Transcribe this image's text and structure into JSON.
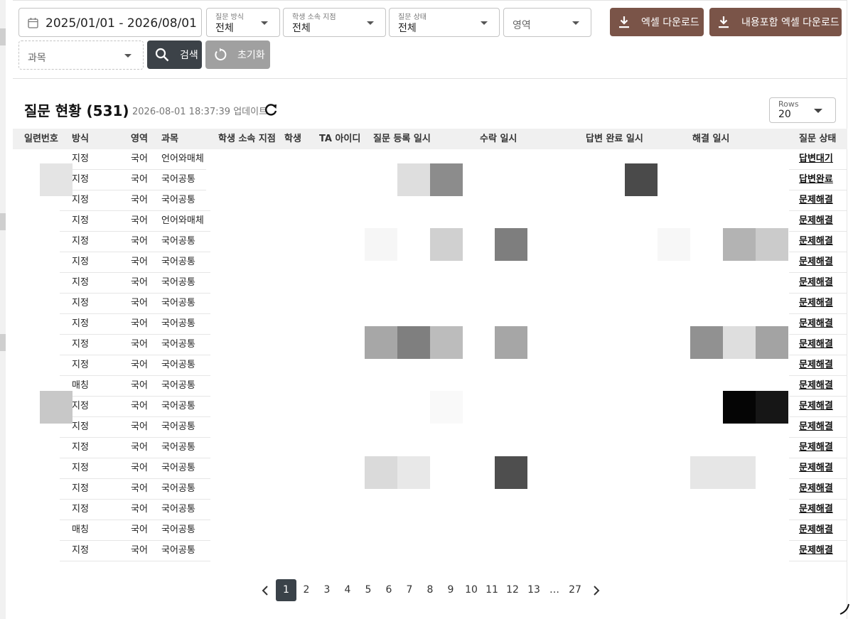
{
  "filters": {
    "date_range": "2025/01/01 - 2026/08/01",
    "method": {
      "caption": "질문 방식",
      "value": "전체"
    },
    "branch": {
      "caption": "학생 소속 지점",
      "value": "전체"
    },
    "status": {
      "caption": "질문 상태",
      "value": "전체"
    },
    "area": {
      "placeholder": "영역"
    },
    "subject": {
      "placeholder": "과목"
    },
    "search_label": "검색",
    "reset_label": "초기화",
    "excel_label": "엑셀 다운로드",
    "excel_full_label": "내용포함 엑셀 다운로드"
  },
  "summary": {
    "title": "질문 현황 (531)",
    "updated": "2026-08-01 18:37:39 업데이트",
    "rows_caption": "Rows",
    "rows_value": "20"
  },
  "table": {
    "columns": [
      "일련번호",
      "방식",
      "영역",
      "과목",
      "학생 소속 지점",
      "학생",
      "TA 아이디",
      "질문 등록 일시",
      "수락 일시",
      "답변 완료 일시",
      "해결 일시",
      "질문 상태"
    ],
    "rows": [
      {
        "method": "지정",
        "area": "국어",
        "subject": "언어와매체",
        "status": "답변대기"
      },
      {
        "method": "지정",
        "area": "국어",
        "subject": "국어공통",
        "status": "답변완료"
      },
      {
        "method": "지정",
        "area": "국어",
        "subject": "국어공통",
        "status": "문제해결"
      },
      {
        "method": "지정",
        "area": "국어",
        "subject": "언어와매체",
        "status": "문제해결"
      },
      {
        "method": "지정",
        "area": "국어",
        "subject": "국어공통",
        "status": "문제해결"
      },
      {
        "method": "지정",
        "area": "국어",
        "subject": "국어공통",
        "status": "문제해결"
      },
      {
        "method": "지정",
        "area": "국어",
        "subject": "국어공통",
        "status": "문제해결"
      },
      {
        "method": "지정",
        "area": "국어",
        "subject": "국어공통",
        "status": "문제해결"
      },
      {
        "method": "지정",
        "area": "국어",
        "subject": "국어공통",
        "status": "문제해결"
      },
      {
        "method": "지정",
        "area": "국어",
        "subject": "국어공통",
        "status": "문제해결"
      },
      {
        "method": "지정",
        "area": "국어",
        "subject": "국어공통",
        "status": "문제해결"
      },
      {
        "method": "매칭",
        "area": "국어",
        "subject": "국어공통",
        "status": "문제해결"
      },
      {
        "method": "지정",
        "area": "국어",
        "subject": "국어공통",
        "status": "문제해결"
      },
      {
        "method": "지정",
        "area": "국어",
        "subject": "국어공통",
        "status": "문제해결"
      },
      {
        "method": "지정",
        "area": "국어",
        "subject": "국어공통",
        "status": "문제해결"
      },
      {
        "method": "지정",
        "area": "국어",
        "subject": "국어공통",
        "status": "문제해결"
      },
      {
        "method": "지정",
        "area": "국어",
        "subject": "국어공통",
        "status": "문제해결"
      },
      {
        "method": "지정",
        "area": "국어",
        "subject": "국어공통",
        "status": "문제해결"
      },
      {
        "method": "매칭",
        "area": "국어",
        "subject": "국어공통",
        "status": "문제해결"
      },
      {
        "method": "지정",
        "area": "국어",
        "subject": "국어공통",
        "status": "문제해결"
      }
    ]
  },
  "pagination": {
    "pages": [
      "1",
      "2",
      "3",
      "4",
      "5",
      "6",
      "7",
      "8",
      "9",
      "10",
      "11",
      "12",
      "13",
      "…",
      "27"
    ],
    "current": "1"
  },
  "colors": {
    "brand_brown": "#7a5448",
    "dark_button": "#3c4248",
    "reset_button": "#a0a0a0"
  },
  "icons": [
    "calendar-icon",
    "download-icon",
    "search-icon",
    "reset-icon",
    "refresh-icon",
    "chevron-left-icon",
    "chevron-right-icon"
  ]
}
